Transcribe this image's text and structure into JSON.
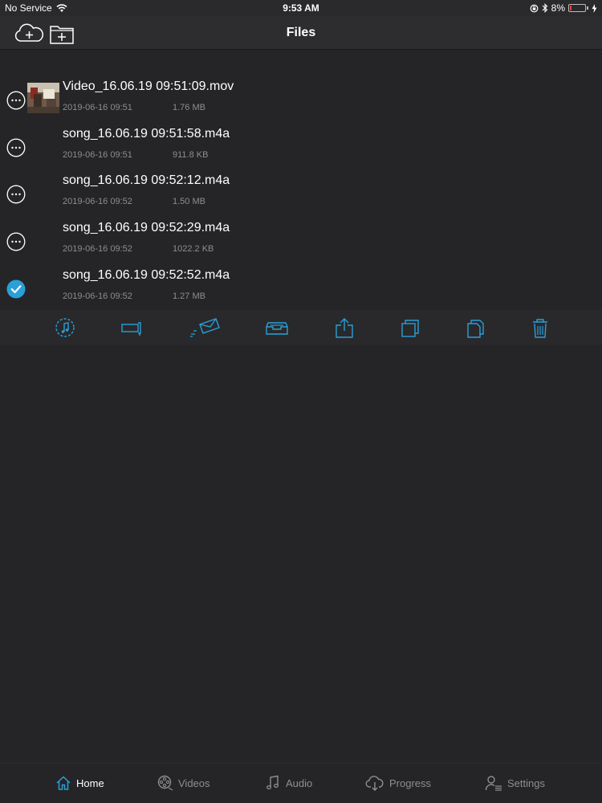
{
  "status_bar": {
    "carrier": "No Service",
    "time": "9:53 AM",
    "battery": "8%"
  },
  "header": {
    "title": "Files",
    "icons": [
      "cloud-add-icon",
      "folder-add-icon"
    ]
  },
  "files": [
    {
      "name": "Video_16.06.19 09:51:09.mov",
      "date": "2019-06-16 09:51",
      "size": "1.76 MB",
      "selected": false,
      "has_thumbnail": true
    },
    {
      "name": "song_16.06.19 09:51:58.m4a",
      "date": "2019-06-16 09:51",
      "size": "911.8 KB",
      "selected": false,
      "has_thumbnail": false
    },
    {
      "name": "song_16.06.19 09:52:12.m4a",
      "date": "2019-06-16 09:52",
      "size": "1.50 MB",
      "selected": false,
      "has_thumbnail": false
    },
    {
      "name": "song_16.06.19 09:52:29.m4a",
      "date": "2019-06-16 09:52",
      "size": "1022.2 KB",
      "selected": false,
      "has_thumbnail": false
    },
    {
      "name": "song_16.06.19 09:52:52.m4a",
      "date": "2019-06-16 09:52",
      "size": "1.27 MB",
      "selected": true,
      "has_thumbnail": false
    }
  ],
  "action_bar": {
    "icons": [
      "music-note-icon",
      "projector-icon",
      "email-icon",
      "archive-icon",
      "share-icon",
      "copy-icon",
      "duplicate-icon",
      "trash-icon"
    ]
  },
  "tabs": [
    {
      "label": "Home",
      "icon": "home-icon",
      "active": true
    },
    {
      "label": "Videos",
      "icon": "film-reel-icon",
      "active": false
    },
    {
      "label": "Audio",
      "icon": "music-note-icon",
      "active": false
    },
    {
      "label": "Progress",
      "icon": "cloud-download-icon",
      "active": false
    },
    {
      "label": "Settings",
      "icon": "user-settings-icon",
      "active": false
    }
  ],
  "colors": {
    "accent": "#2a9fd8",
    "background": "#252527",
    "secondary_text": "#8d8d90",
    "battery_low": "#e0443e"
  }
}
